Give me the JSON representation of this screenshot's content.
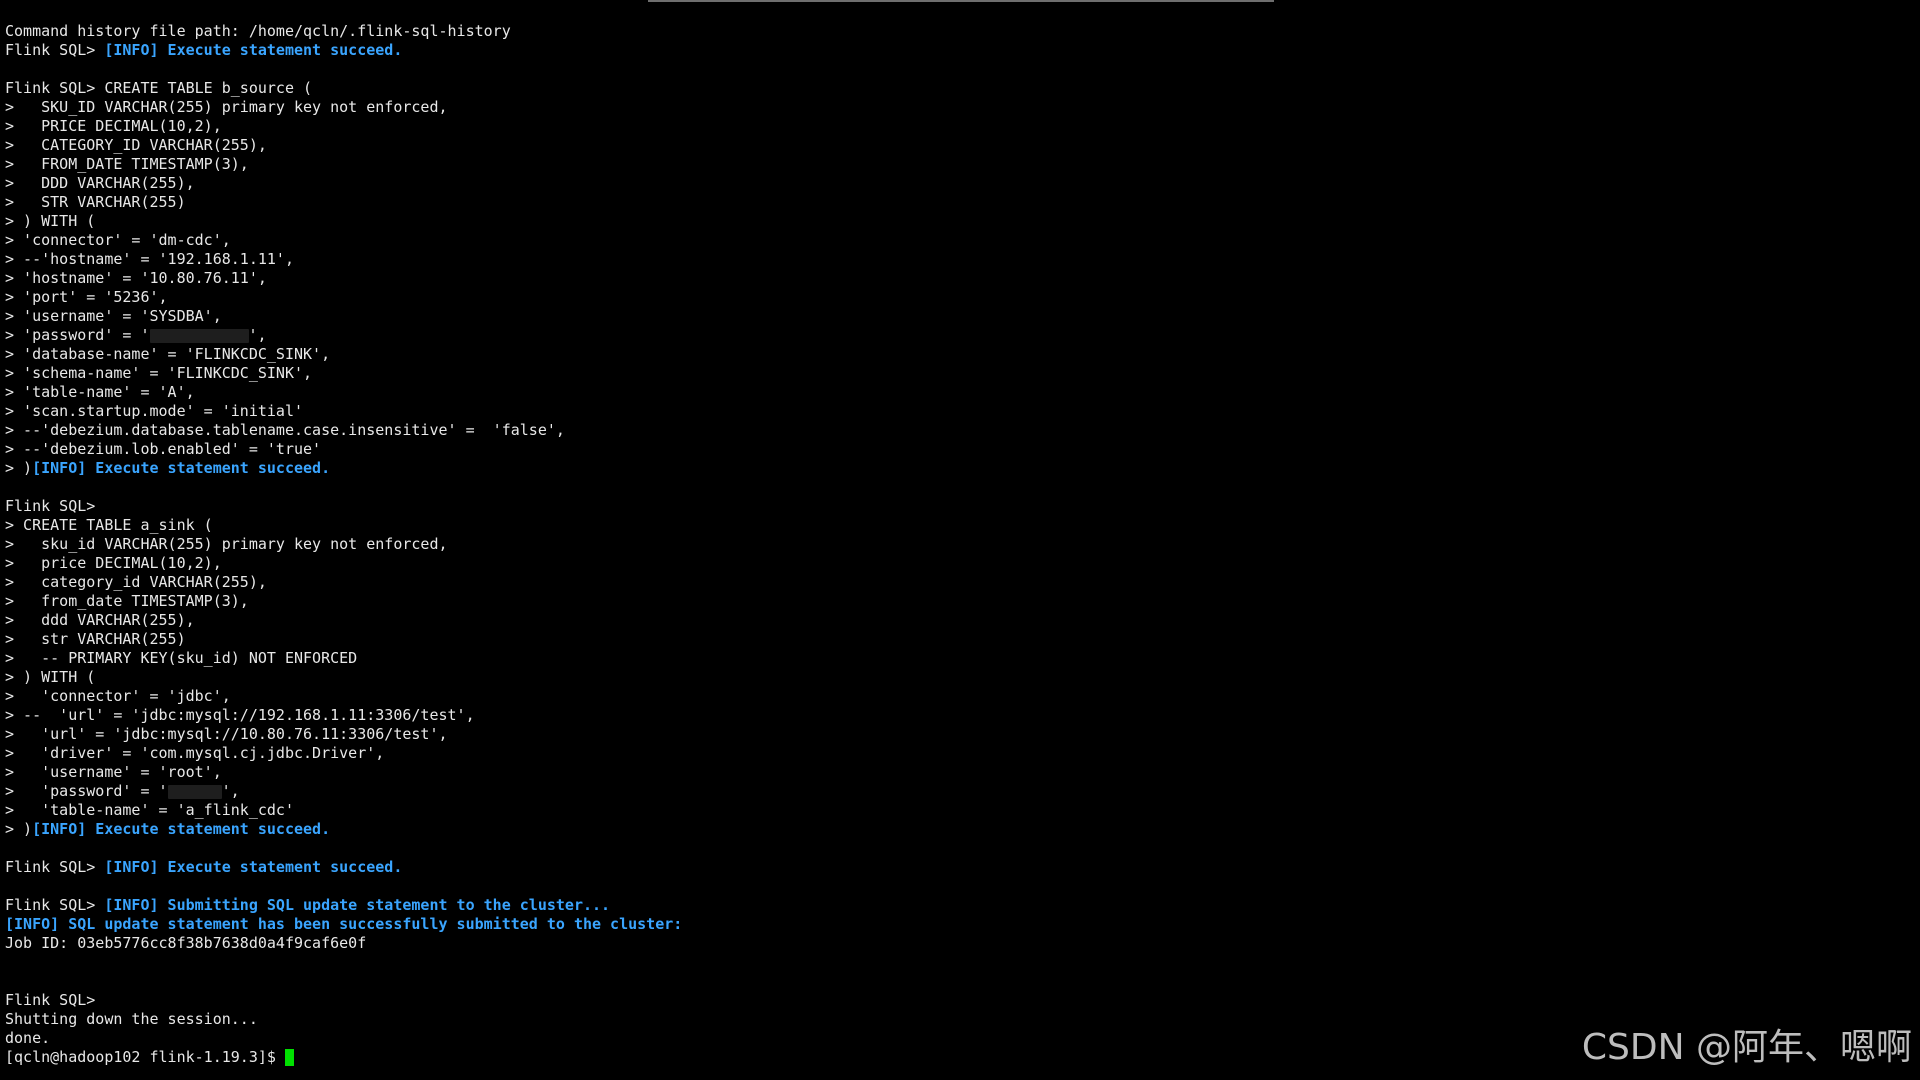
{
  "terminal": {
    "colors": {
      "background": "#000000",
      "text": "#e8e8e8",
      "info": "#3aa5ff",
      "cursor": "#00e000",
      "watermark": "#bdbdbd"
    },
    "lines": [
      [
        {
          "t": "Command history file path: /home/qcln/.flink-sql-history"
        }
      ],
      [
        {
          "t": "Flink SQL> "
        },
        {
          "t": "[INFO] Execute statement succeed.",
          "c": "info"
        }
      ],
      [],
      [
        {
          "t": "Flink SQL> CREATE TABLE b_source ("
        }
      ],
      [
        {
          "t": ">   SKU_ID VARCHAR(255) primary key not enforced,"
        }
      ],
      [
        {
          "t": ">   PRICE DECIMAL(10,2),"
        }
      ],
      [
        {
          "t": ">   CATEGORY_ID VARCHAR(255),"
        }
      ],
      [
        {
          "t": ">   FROM_DATE TIMESTAMP(3),"
        }
      ],
      [
        {
          "t": ">   DDD VARCHAR(255),"
        }
      ],
      [
        {
          "t": ">   STR VARCHAR(255)"
        }
      ],
      [
        {
          "t": "> ) WITH ("
        }
      ],
      [
        {
          "t": "> 'connector' = 'dm-cdc',"
        }
      ],
      [
        {
          "t": "> --'hostname' = '192.168.1.11',"
        }
      ],
      [
        {
          "t": "> 'hostname' = '10.80.76.11',"
        }
      ],
      [
        {
          "t": "> 'port' = '5236',"
        }
      ],
      [
        {
          "t": "> 'username' = 'SYSDBA',"
        }
      ],
      [
        {
          "t": "> 'password' = '"
        },
        {
          "redact": 11
        },
        {
          "t": "',"
        }
      ],
      [
        {
          "t": "> 'database-name' = 'FLINKCDC_SINK',"
        }
      ],
      [
        {
          "t": "> 'schema-name' = 'FLINKCDC_SINK',"
        }
      ],
      [
        {
          "t": "> 'table-name' = 'A',"
        }
      ],
      [
        {
          "t": "> 'scan.startup.mode' = 'initial'"
        }
      ],
      [
        {
          "t": "> --'debezium.database.tablename.case.insensitive' =  'false',"
        }
      ],
      [
        {
          "t": "> --'debezium.lob.enabled' = 'true'"
        }
      ],
      [
        {
          "t": "> )"
        },
        {
          "t": "[INFO] Execute statement succeed.",
          "c": "info"
        }
      ],
      [],
      [
        {
          "t": "Flink SQL>"
        }
      ],
      [
        {
          "t": "> CREATE TABLE a_sink ("
        }
      ],
      [
        {
          "t": ">   sku_id VARCHAR(255) primary key not enforced,"
        }
      ],
      [
        {
          "t": ">   price DECIMAL(10,2),"
        }
      ],
      [
        {
          "t": ">   category_id VARCHAR(255),"
        }
      ],
      [
        {
          "t": ">   from_date TIMESTAMP(3),"
        }
      ],
      [
        {
          "t": ">   ddd VARCHAR(255),"
        }
      ],
      [
        {
          "t": ">   str VARCHAR(255)"
        }
      ],
      [
        {
          "t": ">   -- PRIMARY KEY(sku_id) NOT ENFORCED"
        }
      ],
      [
        {
          "t": "> ) WITH ("
        }
      ],
      [
        {
          "t": ">   'connector' = 'jdbc',"
        }
      ],
      [
        {
          "t": "> --  'url' = 'jdbc:mysql://192.168.1.11:3306/test',"
        }
      ],
      [
        {
          "t": ">   'url' = 'jdbc:mysql://10.80.76.11:3306/test',"
        }
      ],
      [
        {
          "t": ">   'driver' = 'com.mysql.cj.jdbc.Driver',"
        }
      ],
      [
        {
          "t": ">   'username' = 'root',"
        }
      ],
      [
        {
          "t": ">   'password' = '"
        },
        {
          "redact": 6
        },
        {
          "t": "',"
        }
      ],
      [
        {
          "t": ">   'table-name' = 'a_flink_cdc'"
        }
      ],
      [
        {
          "t": "> )"
        },
        {
          "t": "[INFO] Execute statement succeed.",
          "c": "info"
        }
      ],
      [],
      [
        {
          "t": "Flink SQL> "
        },
        {
          "t": "[INFO] Execute statement succeed.",
          "c": "info"
        }
      ],
      [],
      [
        {
          "t": "Flink SQL> "
        },
        {
          "t": "[INFO] Submitting SQL update statement to the cluster...",
          "c": "info"
        }
      ],
      [
        {
          "t": "[INFO] SQL update statement has been successfully submitted to the cluster:",
          "c": "info"
        }
      ],
      [
        {
          "t": "Job ID: 03eb5776cc8f38b7638d0a4f9caf6e0f"
        }
      ],
      [],
      [],
      [
        {
          "t": "Flink SQL>"
        }
      ],
      [
        {
          "t": "Shutting down the session..."
        }
      ],
      [
        {
          "t": "done."
        }
      ],
      [
        {
          "t": "[qcln@hadoop102 flink-1.19.3]$ "
        },
        {
          "cursor": true
        }
      ]
    ]
  },
  "watermark": {
    "text": "CSDN @阿年、嗯啊"
  }
}
